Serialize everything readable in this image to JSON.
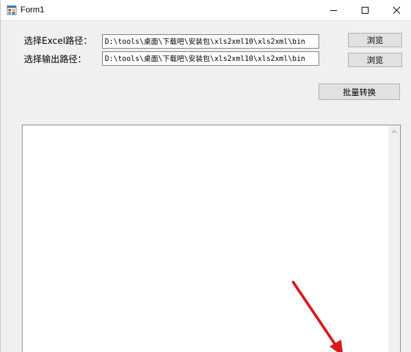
{
  "window": {
    "title": "Form1"
  },
  "form": {
    "excel_label": "选择Excel路径：",
    "output_label": "选择输出路径：",
    "excel_path": "D:\\tools\\桌面\\下载吧\\安装包\\xls2xml10\\xls2xml\\bin",
    "output_path": "D:\\tools\\桌面\\下载吧\\安装包\\xls2xml10\\xls2xml\\bin",
    "browse_label": "浏览",
    "browse_output_label": "浏览",
    "batch_label": "批量转换"
  },
  "log": {
    "content": ""
  },
  "icons": {
    "app": "form-app-icon",
    "minimize": "minimize-icon",
    "maximize": "maximize-icon",
    "close": "close-icon",
    "scroll_up": "scroll-up-arrow-icon",
    "annotation": "red-arrow-annotation-icon"
  },
  "colors": {
    "window_bg": "#f0f0f0",
    "button_bg": "#e1e1e1",
    "annotation": "#d9191e"
  }
}
